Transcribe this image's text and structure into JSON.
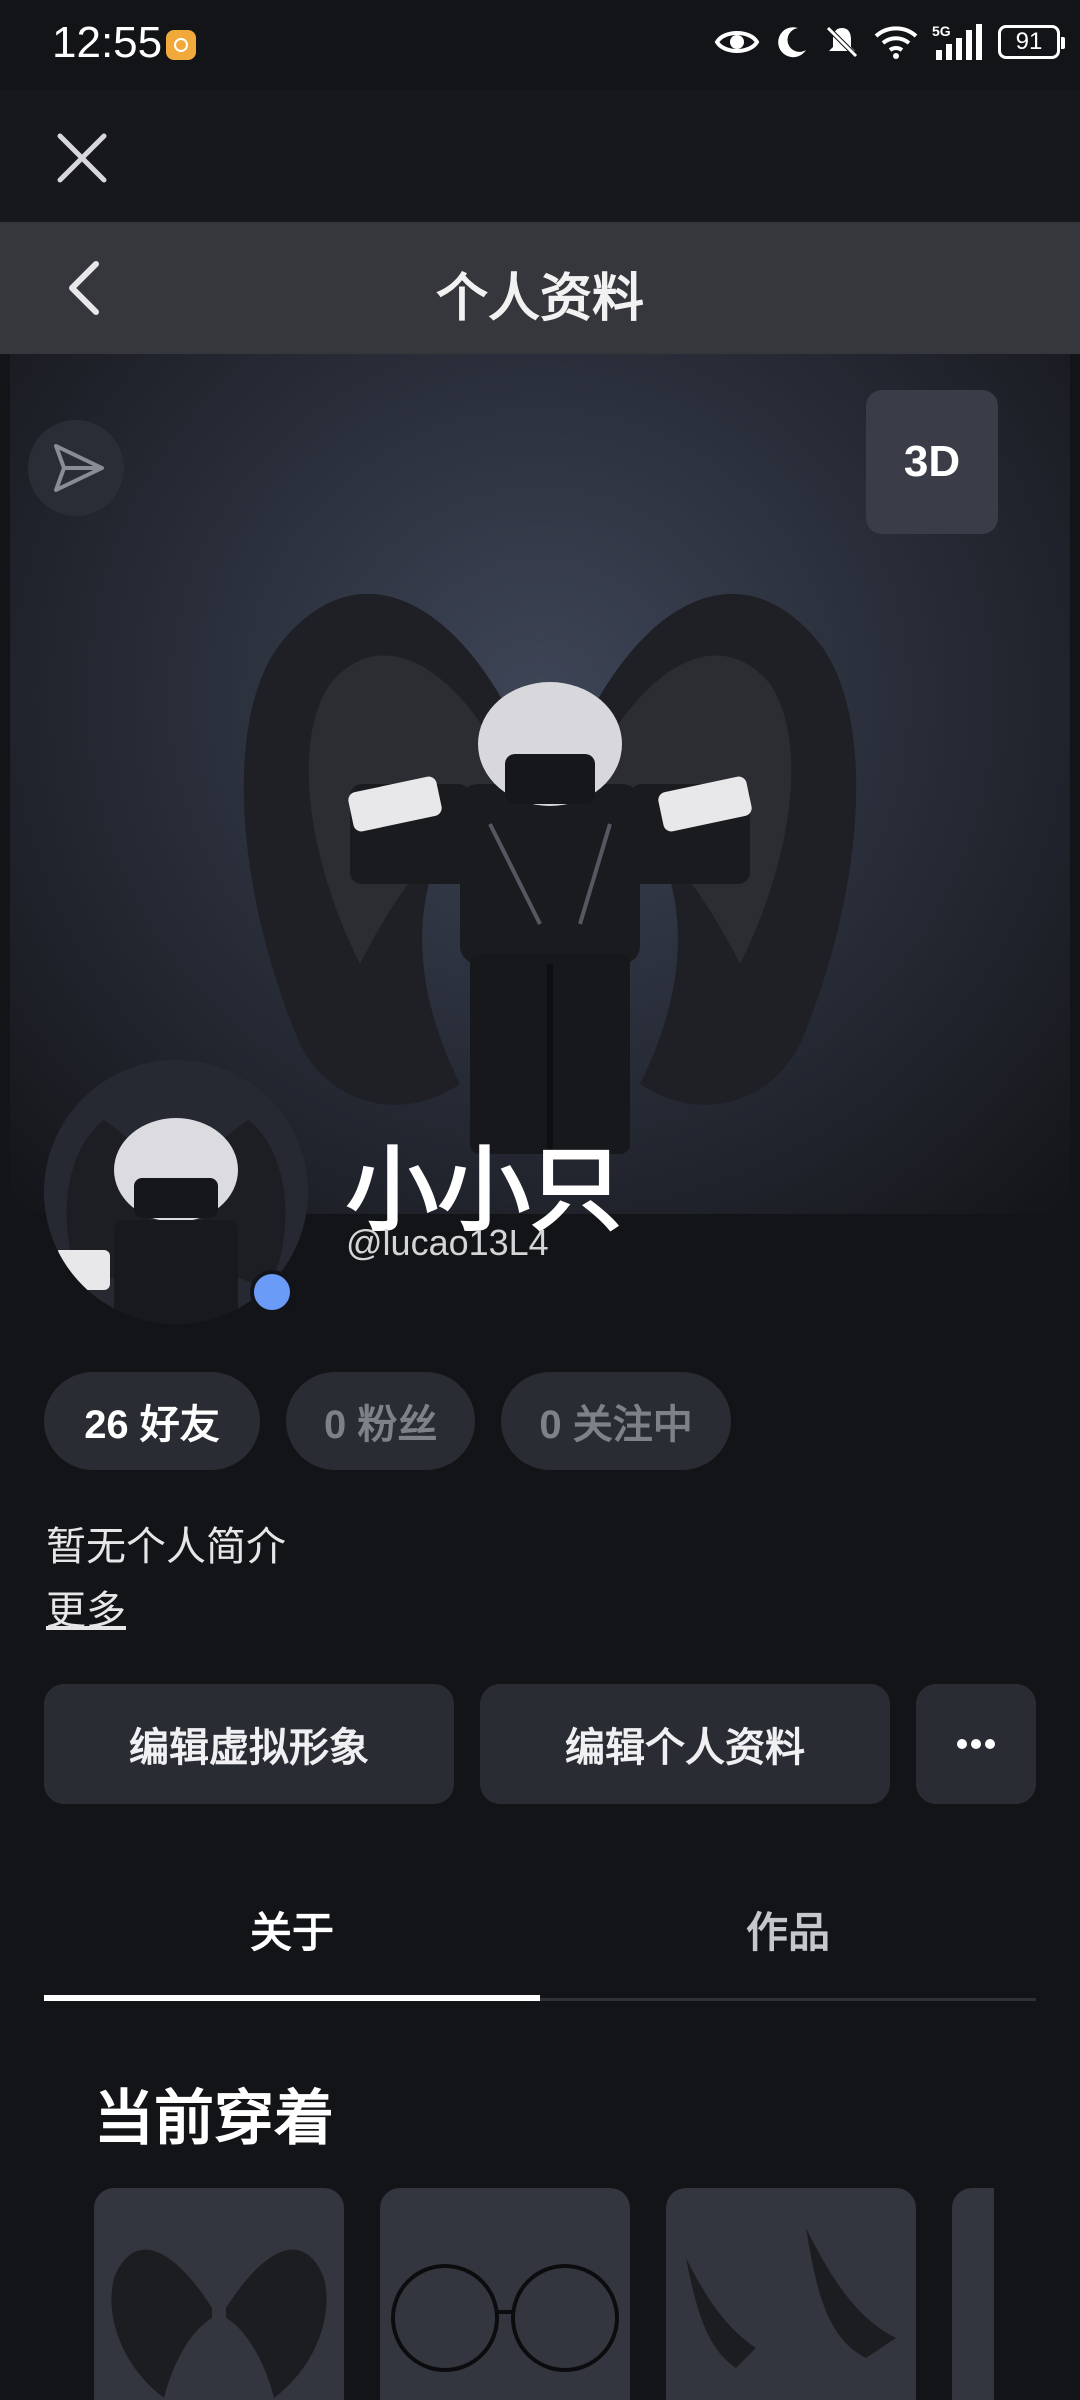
{
  "status_bar": {
    "time": "12:55",
    "battery": "91",
    "icons": [
      "alarm-icon",
      "eye-icon",
      "moon-icon",
      "mute-icon",
      "wifi-icon",
      "5g-signal-icon",
      "battery-icon"
    ]
  },
  "header": {
    "title": "个人资料",
    "close_icon": "close-icon",
    "back_icon": "chevron-left-icon"
  },
  "hero": {
    "btn_3d": "3D",
    "share_icon": "send-icon"
  },
  "profile": {
    "display_name": "小小只",
    "username": "@lucao13L4",
    "online": true
  },
  "stats": [
    {
      "label": "26 好友"
    },
    {
      "label": "0 粉丝"
    },
    {
      "label": "0 关注中"
    }
  ],
  "bio": {
    "text": "暂无个人简介",
    "more": "更多"
  },
  "actions": {
    "edit_avatar": "编辑虚拟形象",
    "edit_profile": "编辑个人资料",
    "more_icon": "more-horizontal-icon"
  },
  "tabs": [
    {
      "label": "关于",
      "active": true
    },
    {
      "label": "作品",
      "active": false
    }
  ],
  "section": {
    "current_wearing": "当前穿着"
  },
  "items": [
    {
      "icon": "black-wings-icon"
    },
    {
      "icon": "round-glasses-icon"
    },
    {
      "icon": "horns-icon"
    },
    {
      "icon": "item-partial"
    }
  ],
  "colors": {
    "background": "#131418",
    "header": "#36373c",
    "chip": "#2a2c33",
    "online": "#6a9bf7"
  }
}
